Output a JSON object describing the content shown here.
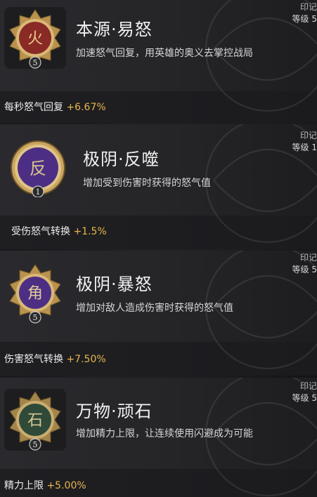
{
  "cards": [
    {
      "title": "本源·易怒",
      "description": "加速怒气回复，用英雄的奥义去掌控战局",
      "stat_label": "每秒怒气回复",
      "stat_value": "+6.67%",
      "level": "5",
      "glyph": "火",
      "emblem_color": "#8a2a26",
      "corner_mark": "印记",
      "corner_level": "等级 5"
    },
    {
      "title": "极阴·反噬",
      "description": "增加受到伤害时获得的怒气值",
      "stat_label": "受伤怒气转换",
      "stat_value": "+1.5%",
      "level": "1",
      "glyph": "反",
      "emblem_color": "#4c2f84",
      "corner_mark": "印记",
      "corner_level": "等级 1"
    },
    {
      "title": "极阴·暴怒",
      "description": "增加对敌人造成伤害时获得的怒气值",
      "stat_label": "伤害怒气转换",
      "stat_value": "+7.50%",
      "level": "5",
      "glyph": "角",
      "emblem_color": "#4c2f84",
      "corner_mark": "印记",
      "corner_level": "等级 5"
    },
    {
      "title": "万物·顽石",
      "description": "增加精力上限，让连续使用闪避成为可能",
      "stat_label": "精力上限",
      "stat_value": "+5.00%",
      "level": "5",
      "glyph": "石",
      "emblem_color": "#2f4a38",
      "corner_mark": "印记",
      "corner_level": "等级 5"
    }
  ]
}
